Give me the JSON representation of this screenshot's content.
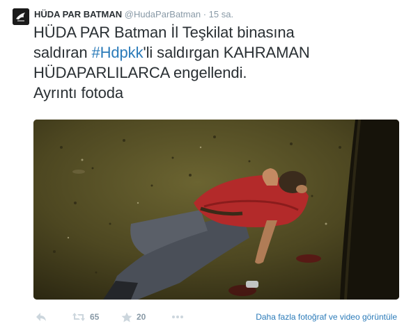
{
  "tweet": {
    "display_name": "HÜDA PAR BATMAN",
    "handle": "@HudaParBatman",
    "separator": "·",
    "time": "15 sa.",
    "text_lines": [
      "HÜDA PAR Batman İl Teşkilat binasına",
      "saldıran ",
      "'li saldırgan KAHRAMAN",
      "HÜDAPARLILARCA engellendi.",
      "Ayrıntı fotoda"
    ],
    "hashtag": "#Hdpkk"
  },
  "actions": {
    "reply_icon": "reply-icon",
    "retweet_icon": "retweet-icon",
    "retweet_count": "65",
    "favorite_icon": "star-icon",
    "favorite_count": "20",
    "more_icon": "more-dots-icon",
    "media_link": "Daha fazla fotoğraf ve video görüntüle"
  },
  "colors": {
    "link": "#2b7bb9",
    "muted": "#8899a6",
    "text": "#292f33"
  }
}
